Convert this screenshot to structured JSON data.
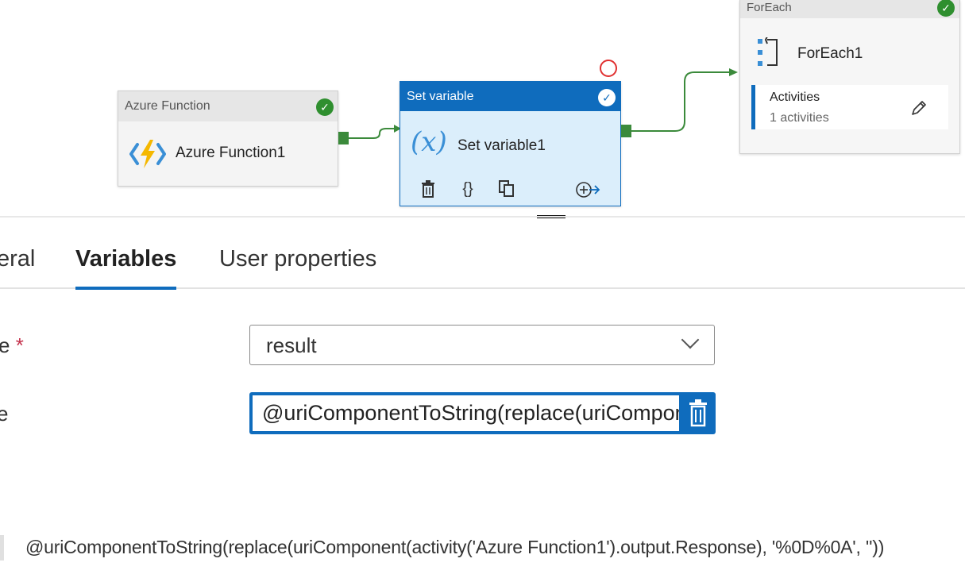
{
  "canvas": {
    "azure_function": {
      "type_label": "Azure Function",
      "name": "Azure Function1",
      "icon": "azure-function-icon",
      "status_icon": "success-check-icon"
    },
    "set_variable": {
      "type_label": "Set variable",
      "name": "Set variable1",
      "icon": "variable-x-icon",
      "status_icon": "success-check-icon",
      "actions": [
        "delete-icon",
        "code-icon",
        "copy-icon",
        "add-output-icon"
      ]
    },
    "foreach": {
      "type_label": "ForEach",
      "name": "ForEach1",
      "icon": "foreach-icon",
      "status_icon": "success-check-icon",
      "activities_label": "Activities",
      "activities_count": "1 activities",
      "edit_icon": "pencil-icon"
    }
  },
  "tabs": [
    {
      "label": "eral",
      "active": false
    },
    {
      "label": "Variables",
      "active": true
    },
    {
      "label": "User properties",
      "active": false
    }
  ],
  "form": {
    "name_label": "e",
    "name_required_mark": "*",
    "name_value": "result",
    "value_label": "e",
    "value_text": "@uriComponentToString(replace(uriComponent(activity('Azure Function1').output.Response), '%0D%0A', ''))"
  },
  "expression_preview": "@uriComponentToString(replace(uriComponent(activity('Azure Function1').output.Response), '%0D%0A', ''))",
  "colors": {
    "accent": "#0f6cbd",
    "success": "#2f8f2f",
    "required": "#c4314b"
  }
}
